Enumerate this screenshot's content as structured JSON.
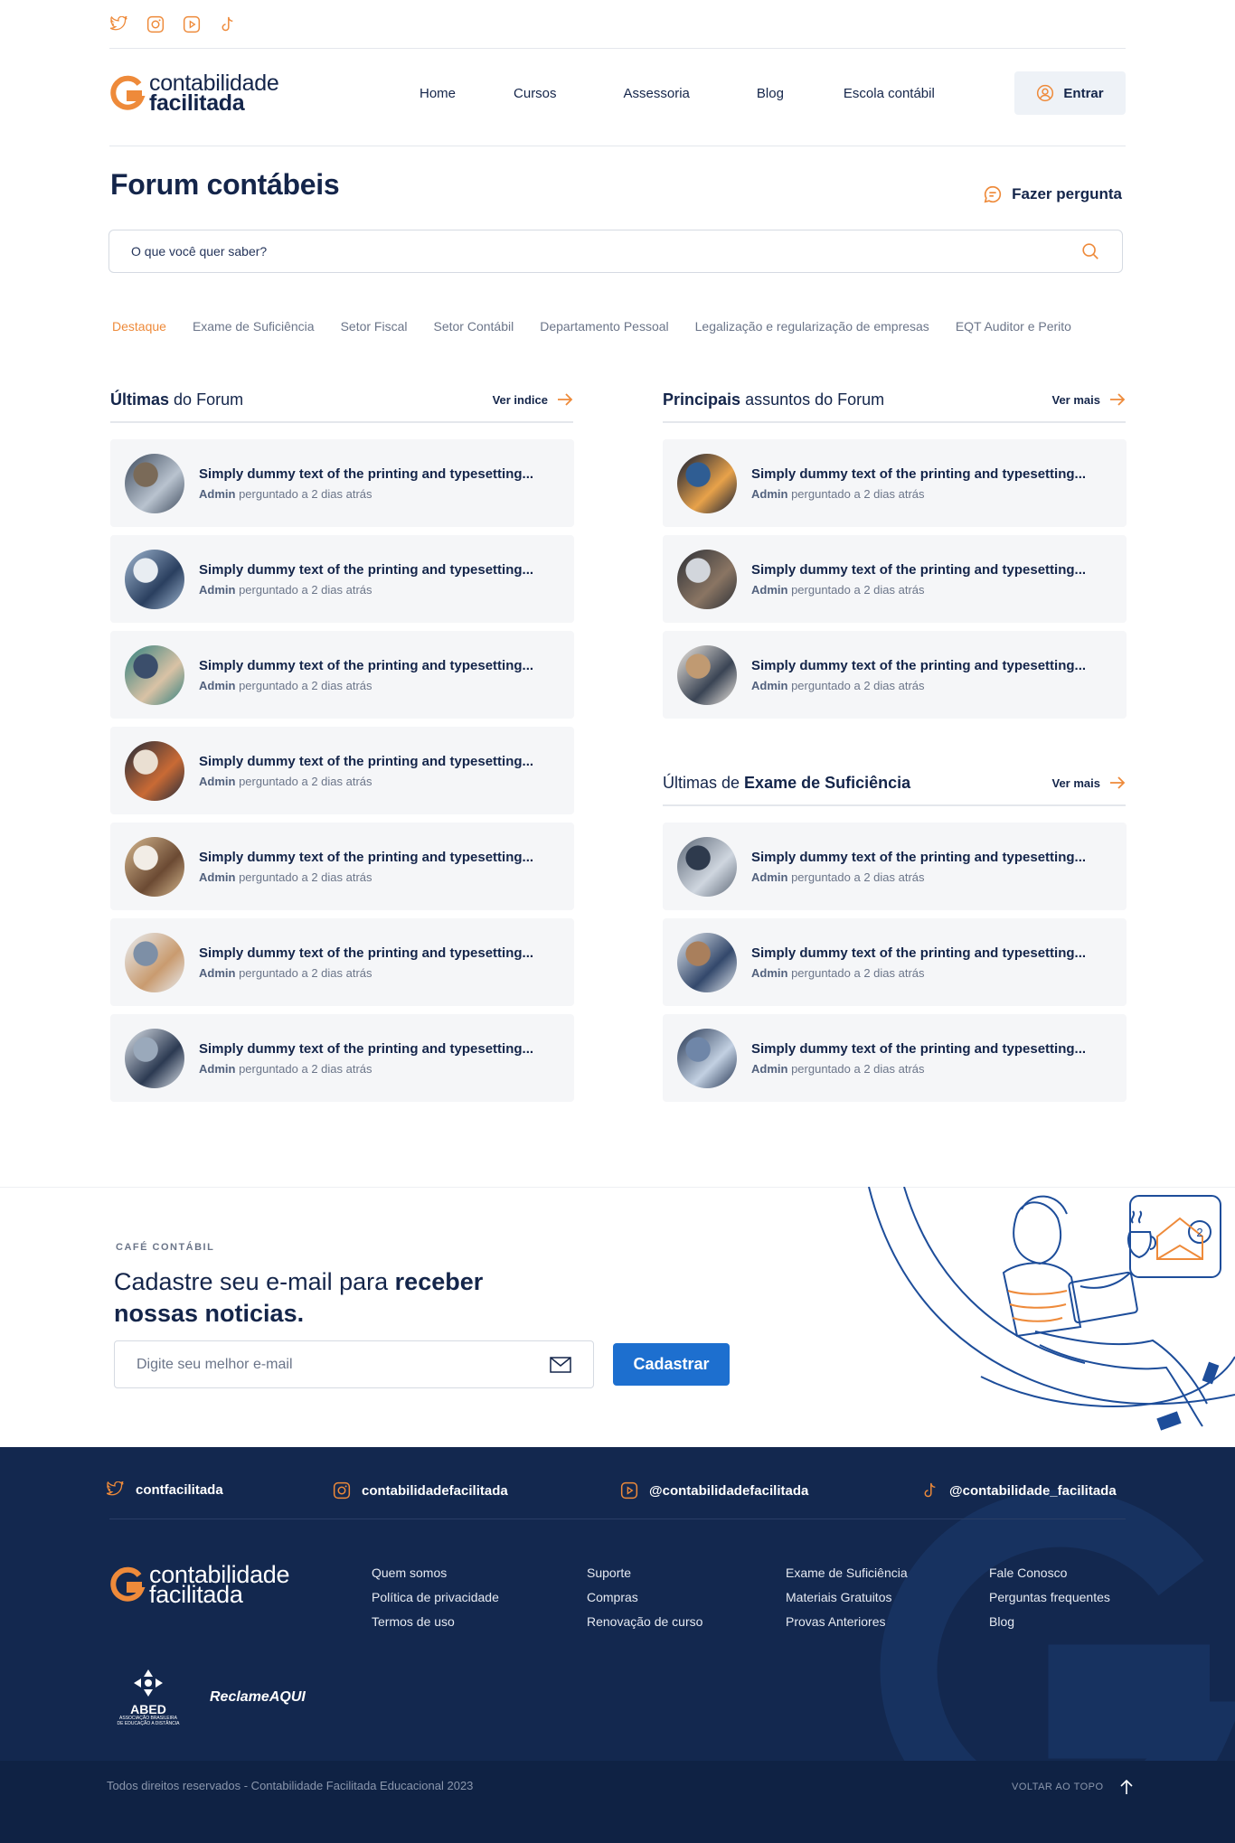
{
  "colors": {
    "primary": "#14254a",
    "accent": "#ee8a3a",
    "button": "#1d6fcf",
    "footer": "#13284f"
  },
  "top_social": {
    "icons": [
      "twitter-icon",
      "instagram-icon",
      "youtube-icon",
      "tiktok-icon"
    ]
  },
  "header": {
    "logo_line1": "contabilidade",
    "logo_line2": "facilitada",
    "nav": [
      "Home",
      "Cursos",
      "Assessoria",
      "Blog",
      "Escola contábil"
    ],
    "login_label": "Entrar"
  },
  "forum": {
    "title": "Forum contábeis",
    "ask_label": "Fazer pergunta",
    "search_placeholder": "O que você quer saber?",
    "tabs": [
      "Destaque",
      "Exame de Suficiência",
      "Setor Fiscal",
      "Setor Contábil",
      "Departamento Pessoal",
      "Legalização e regularização de empresas",
      "EQT Auditor e Perito"
    ]
  },
  "left_col": {
    "title_bold": "Últimas",
    "title_rest": "do Forum",
    "more_label": "Ver indice",
    "items": [
      {
        "q": "Simply dummy text of the printing and typesetting...",
        "author": "Admin",
        "meta": "perguntado a 2 dias atrás"
      },
      {
        "q": "Simply dummy text of the printing and typesetting...",
        "author": "Admin",
        "meta": "perguntado a 2 dias atrás"
      },
      {
        "q": "Simply dummy text of the printing and typesetting...",
        "author": "Admin",
        "meta": "perguntado a 2 dias atrás"
      },
      {
        "q": "Simply dummy text of the printing and typesetting...",
        "author": "Admin",
        "meta": "perguntado a 2 dias atrás"
      },
      {
        "q": "Simply dummy text of the printing and typesetting...",
        "author": "Admin",
        "meta": "perguntado a 2 dias atrás"
      },
      {
        "q": "Simply dummy text of the printing and typesetting...",
        "author": "Admin",
        "meta": "perguntado a 2 dias atrás"
      },
      {
        "q": "Simply dummy text of the printing and typesetting...",
        "author": "Admin",
        "meta": "perguntado a 2 dias atrás"
      }
    ]
  },
  "right_col1": {
    "title_bold": "Principais",
    "title_rest": "assuntos do Forum",
    "more_label": "Ver mais",
    "items": [
      {
        "q": "Simply dummy text of the printing and typesetting...",
        "author": "Admin",
        "meta": "perguntado a 2 dias atrás"
      },
      {
        "q": "Simply dummy text of the printing and typesetting...",
        "author": "Admin",
        "meta": "perguntado a 2 dias atrás"
      },
      {
        "q": "Simply dummy text of the printing and typesetting...",
        "author": "Admin",
        "meta": "perguntado a 2 dias atrás"
      }
    ]
  },
  "right_col2": {
    "title_pre": "Últimas de",
    "title_bold": "Exame de Suficiência",
    "more_label": "Ver mais",
    "items": [
      {
        "q": "Simply dummy text of the printing and typesetting...",
        "author": "Admin",
        "meta": "perguntado a 2 dias atrás"
      },
      {
        "q": "Simply dummy text of the printing and typesetting...",
        "author": "Admin",
        "meta": "perguntado a 2 dias atrás"
      },
      {
        "q": "Simply dummy text of the printing and typesetting...",
        "author": "Admin",
        "meta": "perguntado a 2 dias atrás"
      }
    ]
  },
  "newsletter": {
    "kicker": "CAFÉ CONTÁBIL",
    "title_pre": "Cadastre seu e-mail para",
    "title_bold1": "receber",
    "title_bold2": "nossas noticias.",
    "placeholder": "Digite seu melhor e-mail",
    "button": "Cadastrar",
    "badge": "2"
  },
  "footer": {
    "social": [
      {
        "icon": "twitter-icon",
        "label": "contfacilitada"
      },
      {
        "icon": "instagram-icon",
        "label": "contabilidadefacilitada"
      },
      {
        "icon": "youtube-icon",
        "label": "@contabilidadefacilitada"
      },
      {
        "icon": "tiktok-icon",
        "label": "@contabilidade_facilitada"
      }
    ],
    "logo_line1": "contabilidade",
    "logo_line2": "facilitada",
    "col1": [
      "Quem somos",
      "Política de privacidade",
      "Termos de uso"
    ],
    "col2": [
      "Suporte",
      "Compras",
      "Renovação de curso"
    ],
    "col3": [
      "Exame de Suficiência",
      "Materiais Gratuitos",
      "Provas Anteriores"
    ],
    "col4": [
      "Fale Conosco",
      "Perguntas frequentes",
      "Blog"
    ],
    "abed": "ABED",
    "abed_sub1": "ASSOCIAÇÃO BRASILEIRA",
    "abed_sub2": "DE EDUCAÇÃO A DISTÂNCIA",
    "reclame": "ReclameAQUI",
    "copyright": "Todos direitos reservados - Contabilidade Facilitada Educacional 2023",
    "back_to_top": "VOLTAR AO TOPO"
  }
}
